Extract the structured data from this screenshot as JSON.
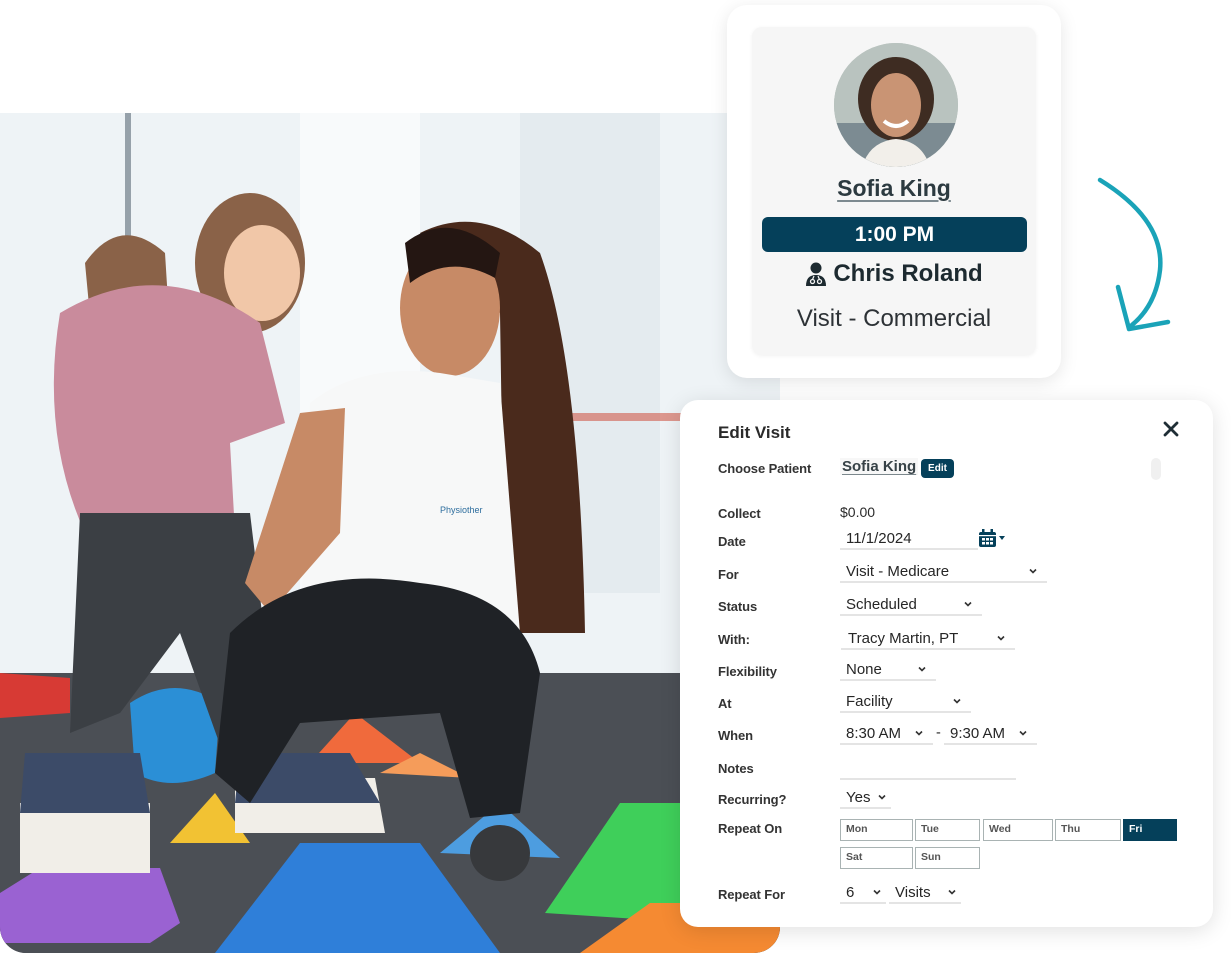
{
  "photo": {
    "alt": "Physiotherapist helping a young girl balance on colorful stepping cones",
    "shirt_text": "Physiother"
  },
  "appointment_card": {
    "patient_name": "Sofia King",
    "time": "1:00 PM",
    "provider_icon": "user-doctor-icon",
    "provider": "Chris Roland",
    "visit_type": "Visit - Commercial"
  },
  "arrow": {
    "color": "#1aa3b8",
    "icon": "curved-arrow-down-icon"
  },
  "edit_visit": {
    "title": "Edit Visit",
    "close_icon": "close-icon",
    "fields": {
      "patient": {
        "label": "Choose Patient",
        "value": "Sofia King",
        "edit_label": "Edit"
      },
      "collect": {
        "label": "Collect",
        "value": "$0.00"
      },
      "date": {
        "label": "Date",
        "value": "11/1/2024",
        "icon": "calendar-icon"
      },
      "for": {
        "label": "For",
        "value": "Visit - Medicare"
      },
      "status": {
        "label": "Status",
        "value": "Scheduled"
      },
      "with": {
        "label": "With:",
        "value": "Tracy Martin, PT"
      },
      "flexibility": {
        "label": "Flexibility",
        "value": "None"
      },
      "at": {
        "label": "At",
        "value": "Facility"
      },
      "when": {
        "label": "When",
        "start": "8:30 AM",
        "separator": "-",
        "end": "9:30 AM"
      },
      "notes": {
        "label": "Notes",
        "value": ""
      },
      "recurring": {
        "label": "Recurring?",
        "value": "Yes"
      },
      "repeat_on": {
        "label": "Repeat On",
        "days": [
          {
            "label": "Mon",
            "selected": false
          },
          {
            "label": "Tue",
            "selected": false
          },
          {
            "label": "Wed",
            "selected": false
          },
          {
            "label": "Thu",
            "selected": false
          },
          {
            "label": "Fri",
            "selected": true
          },
          {
            "label": "Sat",
            "selected": false
          },
          {
            "label": "Sun",
            "selected": false
          }
        ]
      },
      "repeat_for": {
        "label": "Repeat For",
        "count": "6",
        "unit": "Visits"
      }
    }
  },
  "colors": {
    "brand_navy": "#05405a",
    "accent_teal": "#1aa3b8"
  }
}
